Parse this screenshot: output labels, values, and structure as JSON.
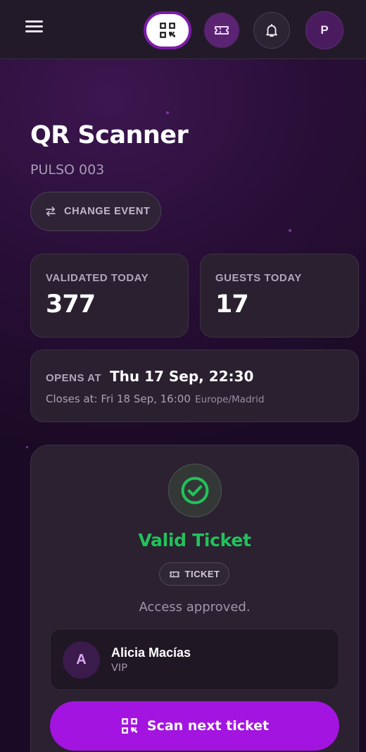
{
  "header": {
    "menu_icon": "hamburger-menu-icon",
    "nav_icons": [
      "qr-code-icon",
      "ticket-icon",
      "bell-icon"
    ],
    "avatar_initial": "P",
    "accent_color": "#a314e0"
  },
  "page": {
    "title": "QR Scanner",
    "event_name": "PULSO 003",
    "change_event_label": "CHANGE EVENT"
  },
  "stats": {
    "validated_label": "VALIDATED TODAY",
    "validated_value": "377",
    "guests_label": "GUESTS TODAY",
    "guests_value": "17"
  },
  "schedule": {
    "opens_label": "OPENS AT",
    "opens_value": "Thu 17 Sep, 22:30",
    "closes_text": "Closes at: Fri 18 Sep, 16:00",
    "timezone": "Europe/Madrid"
  },
  "result": {
    "status_icon": "check-circle-icon",
    "status_title": "Valid Ticket",
    "status_color": "#22c25a",
    "ticket_type": "TICKET",
    "message": "Access approved.",
    "guest": {
      "initial": "A",
      "name": "Alicia Macías",
      "tier": "VIP"
    },
    "scan_next_label": "Scan next ticket"
  }
}
